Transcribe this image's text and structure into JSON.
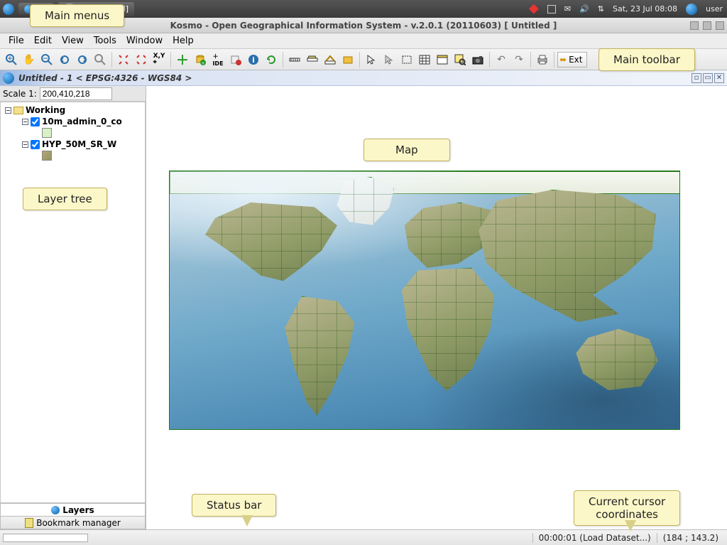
{
  "system_bar": {
    "task_kosmo": "K…",
    "task_pgadmin": "[pgAdmin III]",
    "clock": "Sat, 23 Jul  08:08",
    "user": "user"
  },
  "app": {
    "title": "Kosmo - Open Geographical Information System - v.2.0.1 (20110603)  [ Untitled ]"
  },
  "menus": [
    "File",
    "Edit",
    "View",
    "Tools",
    "Window",
    "Help"
  ],
  "toolbar": {
    "ext_label": "Ext"
  },
  "doc": {
    "title": "Untitled - 1 < EPSG:4326 - WGS84 >"
  },
  "scale": {
    "label": "Scale 1:",
    "value": "200,410,218"
  },
  "tree": {
    "root": "Working",
    "layers": [
      {
        "name": "10m_admin_0_co",
        "checked": true,
        "swatch": "#d7f0c5"
      },
      {
        "name": "HYP_50M_SR_W",
        "checked": true,
        "swatch": "#b7a873"
      }
    ]
  },
  "side_tabs": {
    "layers": "Layers",
    "bookmarks": "Bookmark manager"
  },
  "status": {
    "load_msg": "00:00:01 (Load Dataset...)",
    "coords": "(184 ; 143.2)"
  },
  "callouts": {
    "menus": "Main menus",
    "toolbar": "Main toolbar",
    "tree": "Layer tree",
    "map": "Map",
    "status": "Status bar",
    "coords": "Current cursor\ncoordinates"
  }
}
